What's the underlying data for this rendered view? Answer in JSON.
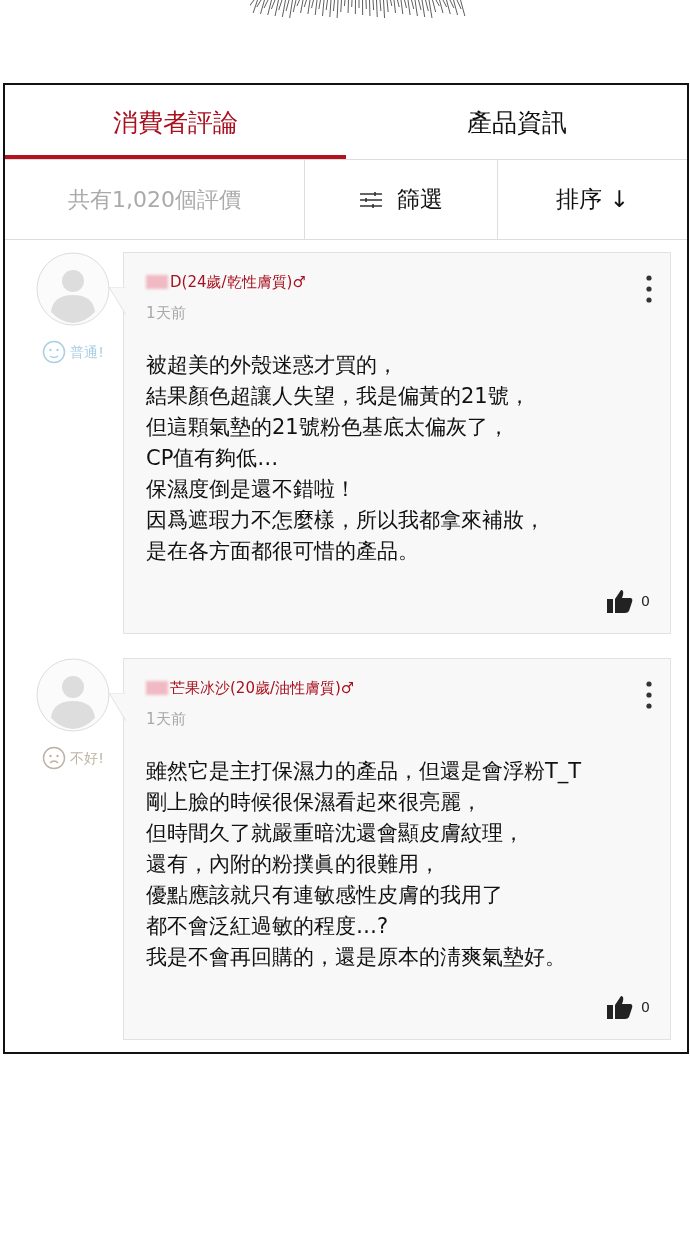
{
  "tabs": [
    {
      "label": "消費者評論",
      "selected": true
    },
    {
      "label": "產品資訊",
      "selected": false
    }
  ],
  "toolbar": {
    "count": "共有1,020個評價",
    "filter": "篩選",
    "sort": "排序 ↓"
  },
  "reviews": [
    {
      "user": "D(24歲/乾性膚質)♂",
      "time": "1天前",
      "rating": {
        "kind": "neutral",
        "label": "普通!",
        "color": "#a9d0e3"
      },
      "body": [
        "被超美的外殼迷惑才買的，",
        "結果顏色超讓人失望，我是偏黃的21號，",
        "但這顆氣墊的21號粉色基底太偏灰了，",
        "CP值有夠低…",
        "保濕度倒是還不錯啦！",
        "因爲遮瑕力不怎麼樣，所以我都拿來補妝，",
        "是在各方面都很可惜的產品。"
      ],
      "likes": "0"
    },
    {
      "user": "芒果冰沙(20歲/油性膚質)♂",
      "time": "1天前",
      "rating": {
        "kind": "bad",
        "label": "不好!",
        "color": "#bdb3a3"
      },
      "body": [
        "雖然它是主打保濕力的產品，但還是會浮粉T_T",
        "剛上臉的時候很保濕看起來很亮麗，",
        "但時間久了就嚴重暗沈還會顯皮膚紋理，",
        "還有，內附的粉撲眞的很難用，",
        "優點應該就只有連敏感性皮膚的我用了",
        "都不會泛紅過敏的程度…?",
        "我是不會再回購的，還是原本的淸爽氣墊好。"
      ],
      "likes": "0"
    }
  ]
}
